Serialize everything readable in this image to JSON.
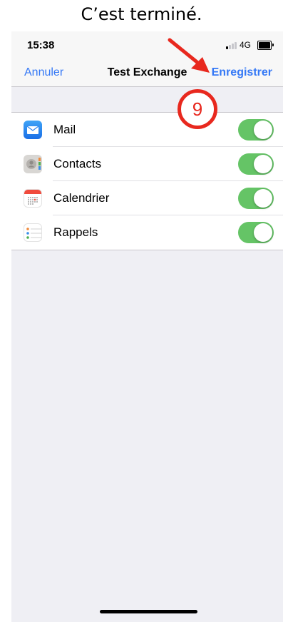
{
  "caption": "C’est terminé.",
  "status_bar": {
    "time": "15:38",
    "network": "4G"
  },
  "nav": {
    "cancel_label": "Annuler",
    "title": "Test Exchange",
    "save_label": "Enregistrer"
  },
  "items": [
    {
      "label": "Mail",
      "icon": "mail-icon",
      "enabled": true
    },
    {
      "label": "Contacts",
      "icon": "contacts-icon",
      "enabled": true
    },
    {
      "label": "Calendrier",
      "icon": "calendar-icon",
      "enabled": true
    },
    {
      "label": "Rappels",
      "icon": "reminders-icon",
      "enabled": true
    }
  ],
  "annotation": {
    "step_number": "9",
    "color": "#e8281e"
  },
  "colors": {
    "accent": "#3478f6",
    "toggle_on": "#65c466",
    "background": "#efeff4"
  }
}
